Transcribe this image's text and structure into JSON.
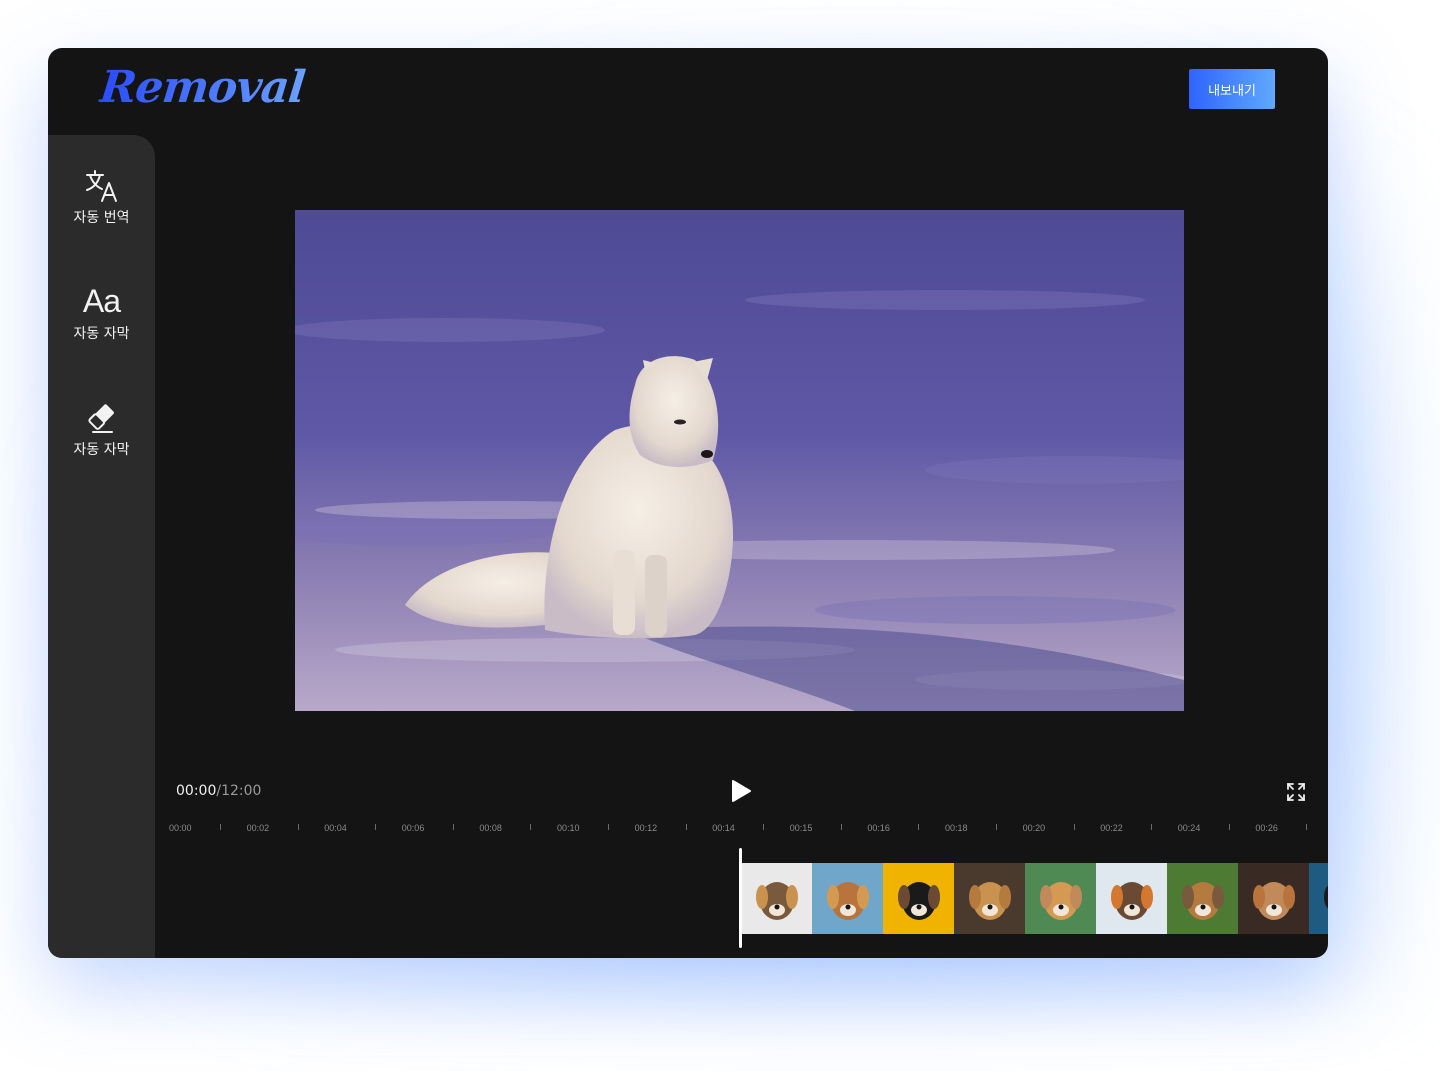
{
  "app": {
    "logo_text": "Removal",
    "export_label": "내보내기"
  },
  "sidebar": {
    "items": [
      {
        "label": "자동 번역",
        "icon": "translate-icon"
      },
      {
        "label": "자동 자막",
        "icon": "text-aa-icon",
        "icon_text": "Aa"
      },
      {
        "label": "자동 자막",
        "icon": "eraser-icon"
      }
    ]
  },
  "player": {
    "current_time": "00:00",
    "total_time": "/12:00",
    "preview": "arctic-fox-in-snow"
  },
  "timeline": {
    "ticks": [
      "00:00",
      "00:02",
      "00:04",
      "00:06",
      "00:08",
      "00:10",
      "00:12",
      "00:14",
      "00:15",
      "00:16",
      "00:18",
      "00:20",
      "00:22",
      "00:24",
      "00:26"
    ],
    "thumbnails": [
      {
        "subject": "collie-dog",
        "bg": "#e9e9e9"
      },
      {
        "subject": "dog-on-beach",
        "bg": "#6fa6c9"
      },
      {
        "subject": "black-pug",
        "bg": "#f0b400"
      },
      {
        "subject": "golden-puppy",
        "bg": "#4a3a2e"
      },
      {
        "subject": "beagle",
        "bg": "#4f8a55"
      },
      {
        "subject": "aussie-dog",
        "bg": "#dfe8ef"
      },
      {
        "subject": "running-dog",
        "bg": "#4d7b33"
      },
      {
        "subject": "spaniel-puppy",
        "bg": "#3a2a24"
      },
      {
        "subject": "shiba-dog",
        "bg": "#1f5a80"
      }
    ]
  },
  "colors": {
    "accent": "#2e64ff",
    "background": "#141414",
    "sidebar": "#2b2b2b"
  }
}
